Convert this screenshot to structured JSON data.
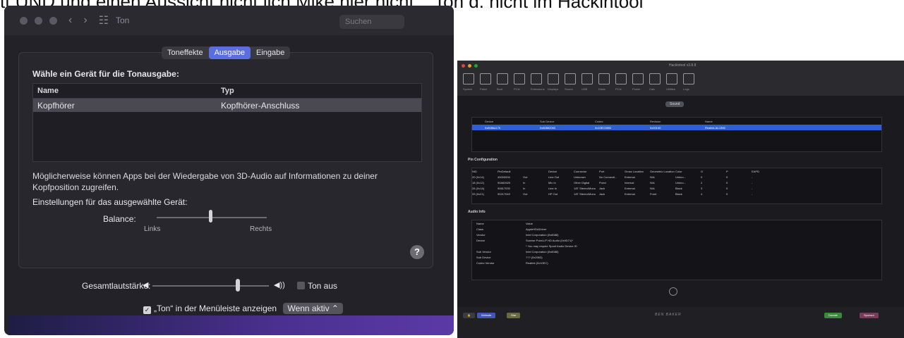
{
  "caption": "tt UND und einen Aussicht nicht lich Mike hier nicht... Ton d. nicht im Hackintool",
  "left": {
    "window_title": "Ton",
    "search_placeholder": "Suchen",
    "tabs": [
      "Toneffekte",
      "Ausgabe",
      "Eingabe"
    ],
    "active_tab": "Ausgabe",
    "heading": "Wähle ein Gerät für die Tonausgabe:",
    "table": {
      "headers": [
        "Name",
        "Typ"
      ],
      "rows": [
        [
          "Kopfhörer",
          "Kopfhörer-Anschluss"
        ]
      ]
    },
    "info_text": "Möglicherweise können Apps bei der Wiedergabe von 3D-Audio auf Informationen zu deiner Kopfposition zugreifen.",
    "settings_label": "Einstellungen für das ausgewählte Gerät:",
    "balance_label": "Balance:",
    "balance_left": "Links",
    "balance_right": "Rechts",
    "balance_value": 0.5,
    "help": "?",
    "volume_label": "Gesamtlautstärke:",
    "volume_value": 0.75,
    "mute_label": "Ton aus",
    "menu_label": "„Ton“ in der Menüleiste anzeigen",
    "menu_popup": "Wenn aktiv"
  },
  "right": {
    "window_title": "Hackintool v3.8.8",
    "toolbar": [
      "System",
      "Patch",
      "Boot",
      "PCIe",
      "Extensions",
      "Displays",
      "Sound",
      "USB",
      "Disks",
      "PCIe",
      "Power",
      "Calc",
      "Utilities",
      "Logs"
    ],
    "sound_button": "Sound",
    "device_headers": [
      "Device",
      "Sub Device",
      "Codec",
      "Revision",
      "Name"
    ],
    "device_row": [
      "0x8086a170",
      "0x80862063",
      "0x10EC0892",
      "0x00100",
      "Realtek ALC892"
    ],
    "pin_title": "Pin Configuration",
    "pin_headers": [
      "NID",
      "PinDefault",
      "",
      "Device",
      "Connector",
      "Port",
      "Gross Location",
      "Geometric Location",
      "Color",
      "G",
      "P",
      "EAPD"
    ],
    "pin_rows": [
      [
        "20 (0x14)",
        "40000000",
        "Out",
        "Line Out",
        "Unknown",
        "No Connecti...",
        "External",
        "N/A",
        "Unkno...",
        "0",
        "0",
        "-"
      ],
      [
        "18 (0x12)",
        "90A60020",
        "In",
        "Mic In",
        "Other Digital",
        "Fixed",
        "Internal",
        "N/A",
        "Unkno...",
        "2",
        "0",
        "-"
      ],
      [
        "26 (0x1A)",
        "90817030",
        "In",
        "Line In",
        "1/8\" Stereo/Mono",
        "Jack",
        "External",
        "N/A",
        "Black",
        "3",
        "0",
        "-"
      ],
      [
        "33 (0x21)",
        "90217040",
        "Out",
        "HP Out",
        "1/8\" Stereo/Mono",
        "Jack",
        "External",
        "Front",
        "Black",
        "4",
        "0",
        "-"
      ]
    ],
    "audio_title": "Audio Info",
    "audio_headers": [
      "Name",
      "Value"
    ],
    "audio_rows": [
      [
        "Class",
        "AppleHDADriver"
      ],
      [
        "Vendor",
        "Intel Corporation (0x8086)"
      ],
      [
        "Device",
        "Sunrise Point-LP HD Audio (0x9D71)*"
      ],
      [
        "",
        "* You may require Spoof Audio Device ID"
      ],
      [
        "Sub Vendor",
        "Intel Corporation (0x8086)"
      ],
      [
        "Sub Device",
        "??? (0x2063)"
      ],
      [
        "Codec Vendor",
        "Realtek (0x10EC)"
      ]
    ],
    "footer_left": [
      "Website",
      "Star"
    ],
    "brand": "BEN BAKER",
    "footer_right": [
      "Donate",
      "Sponsor"
    ]
  }
}
